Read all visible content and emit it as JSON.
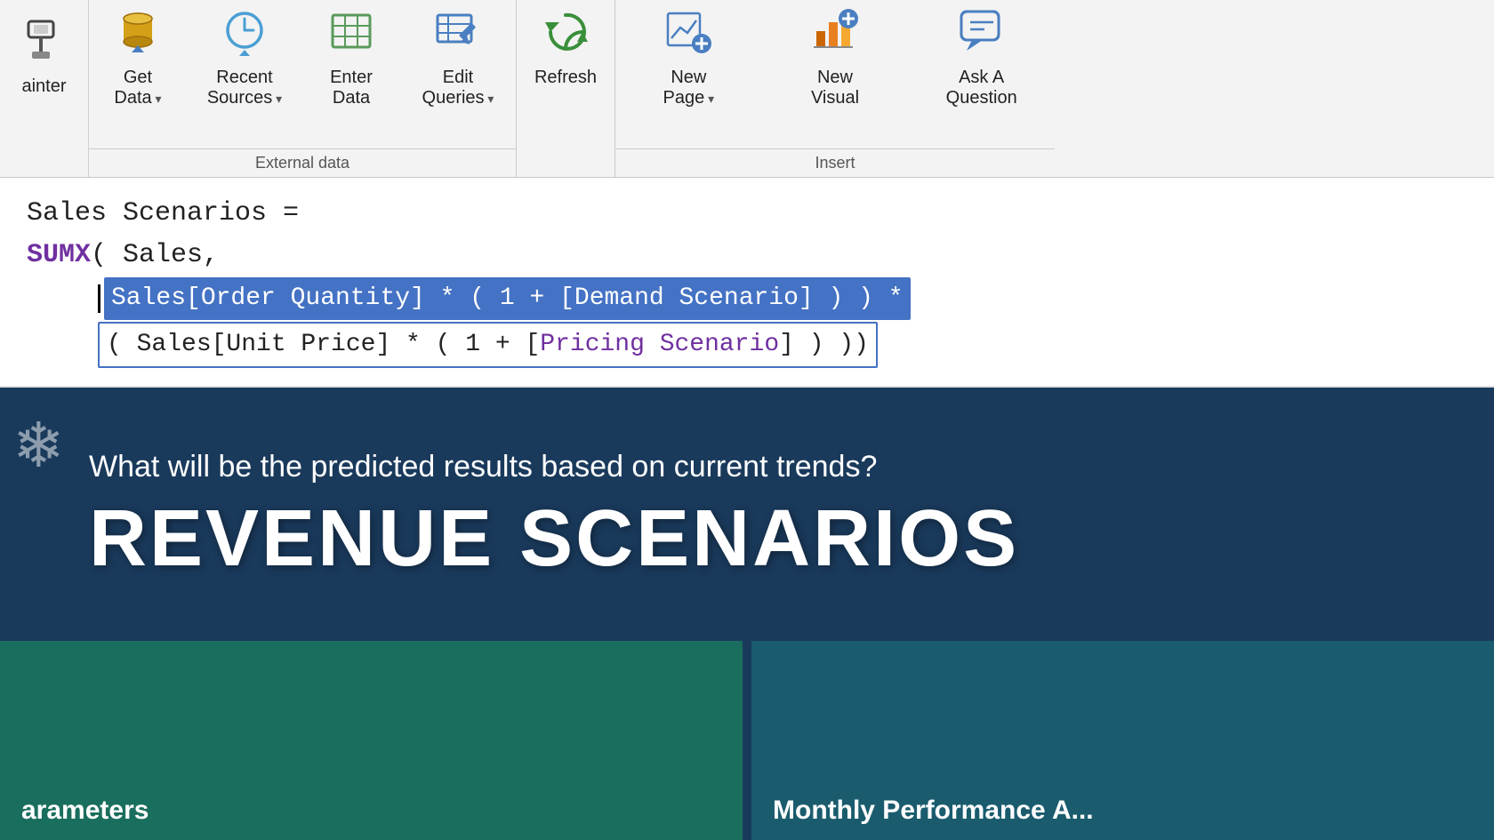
{
  "toolbar": {
    "painter_label": "ainter",
    "get_data": {
      "label_line1": "Get",
      "label_line2": "Data",
      "arrow": "▾"
    },
    "recent_sources": {
      "label_line1": "Recent",
      "label_line2": "Sources",
      "arrow": "▾"
    },
    "enter_data": {
      "label_line1": "Enter",
      "label_line2": "Data"
    },
    "edit_queries": {
      "label_line1": "Edit",
      "label_line2": "Queries",
      "arrow": "▾"
    },
    "external_data_label": "External data",
    "refresh": {
      "label": "Refresh"
    },
    "new_page": {
      "label_line1": "New",
      "label_line2": "Page",
      "arrow": "▾"
    },
    "new_visual": {
      "label_line1": "New",
      "label_line2": "Visual"
    },
    "ask_question": {
      "label_line1": "Ask A",
      "label_line2": "Question"
    },
    "insert_label": "Insert"
  },
  "formula": {
    "line1": "Sales Scenarios =",
    "line2_sumx": "SUMX",
    "line2_rest": "( Sales,",
    "line3_selected": "Sales[Order Quantity] * ( 1 + [Demand Scenario] ) ) *",
    "line3_bracket_open": "[",
    "line3_demand_text": "Demand Scenario",
    "line3_suffix": "] ) ) *",
    "line4_selected": "( Sales[Unit Price] * ( 1 + [Pricing Scenario] ) ))",
    "line4_prefix": "( Sales[Unit Price] * ( 1 + [",
    "line4_pricing_text": "Pricing Scenario",
    "line4_suffix": "] ) ))"
  },
  "lower": {
    "question": "What will be the predicted results based on current trends?",
    "title": "REVENUE SCENARIOS",
    "card_left_label": "arameters",
    "card_right_label": "Monthly Performance A..."
  }
}
